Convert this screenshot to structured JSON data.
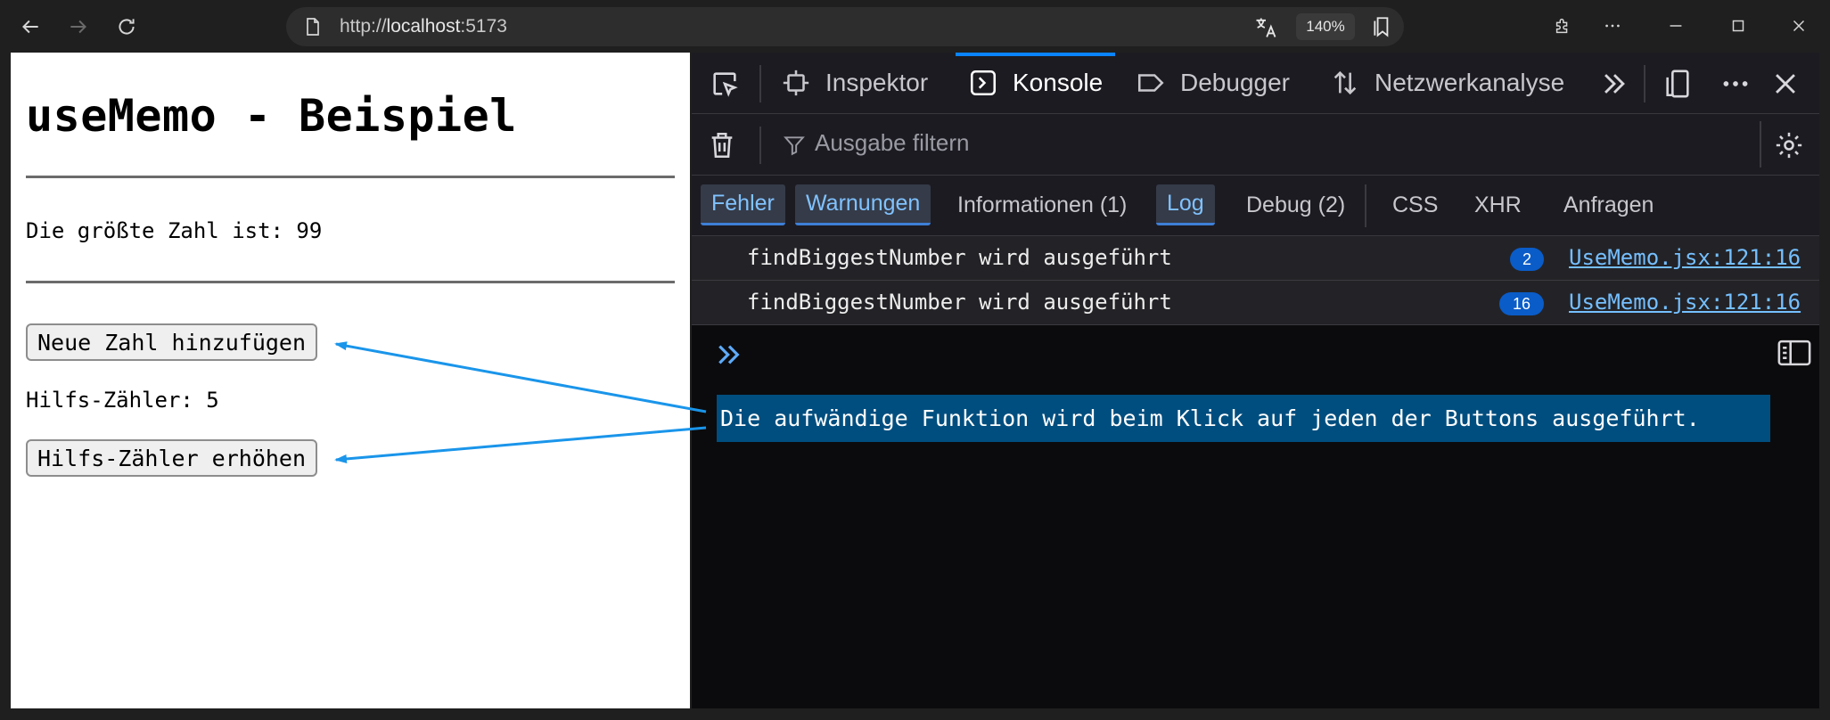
{
  "browser": {
    "url_scheme": "http://",
    "url_host": "localhost",
    "url_port": ":5173",
    "zoom": "140%"
  },
  "page": {
    "title": "useMemo - Beispiel",
    "biggest_number_text": "Die größte Zahl ist: 99",
    "add_number_button": "Neue Zahl hinzufügen",
    "helper_counter_text": "Hilfs-Zähler: 5",
    "increment_counter_button": "Hilfs-Zähler erhöhen"
  },
  "devtools": {
    "tabs": [
      "Inspektor",
      "Konsole",
      "Debugger",
      "Netzwerkanalyse"
    ],
    "active_tab": "Konsole",
    "filter_placeholder": "Ausgabe filtern",
    "levels": [
      {
        "label": "Fehler",
        "active": true
      },
      {
        "label": "Warnungen",
        "active": true
      },
      {
        "label": "Informationen (1)",
        "active": false
      },
      {
        "label": "Log",
        "active": true
      },
      {
        "label": "Debug (2)",
        "active": false
      }
    ],
    "request_filters": [
      "CSS",
      "XHR",
      "Anfragen"
    ],
    "messages": [
      {
        "text": "findBiggestNumber wird ausgeführt",
        "count": "2",
        "source": "UseMemo.jsx:121:16"
      },
      {
        "text": "findBiggestNumber wird ausgeführt",
        "count": "16",
        "source": "UseMemo.jsx:121:16"
      }
    ]
  },
  "annotation": {
    "callout_text": "Die aufwändige Funktion wird beim Klick auf jeden der Buttons ausgeführt.",
    "arrow_color": "#1a95ea"
  },
  "colors": {
    "accent": "#0a84ff",
    "callout_bg": "#004e7f",
    "link": "#75bfff",
    "badge": "#0a5cc8"
  }
}
